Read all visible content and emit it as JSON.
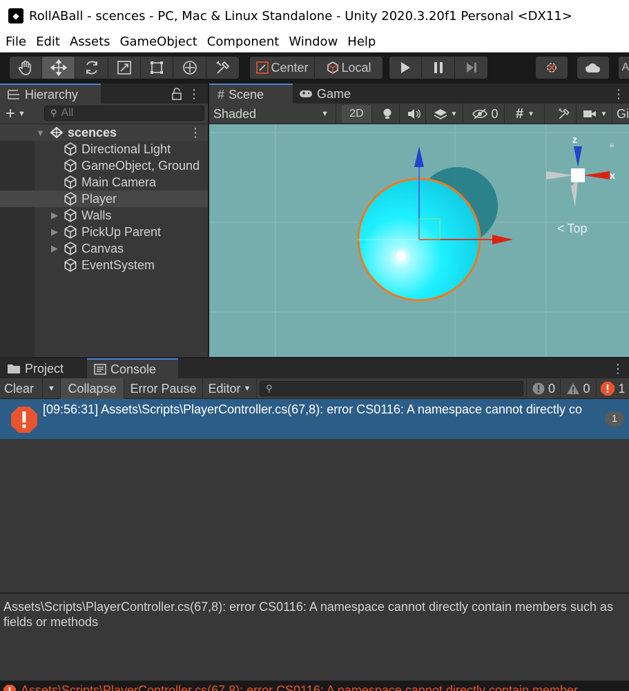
{
  "window": {
    "title": "RollABall - scences - PC, Mac & Linux Standalone - Unity 2020.3.20f1 Personal <DX11>"
  },
  "menu": [
    "File",
    "Edit",
    "Assets",
    "GameObject",
    "Component",
    "Window",
    "Help"
  ],
  "toolbar": {
    "pivot_label": "Center",
    "space_label": "Local"
  },
  "hierarchy": {
    "tab_label": "Hierarchy",
    "search_placeholder": "All",
    "scene_name": "scences",
    "items": [
      {
        "label": "Directional Light"
      },
      {
        "label": "GameObject, Ground"
      },
      {
        "label": "Main Camera"
      },
      {
        "label": "Player"
      },
      {
        "label": "Walls"
      },
      {
        "label": "PickUp Parent"
      },
      {
        "label": "Canvas"
      },
      {
        "label": "EventSystem"
      }
    ],
    "selected_item": "Player"
  },
  "scene": {
    "tabs": [
      {
        "label": "Scene"
      },
      {
        "label": "Game"
      }
    ],
    "shading_mode": "Shaded",
    "mode_2d": "2D",
    "hidden_count": "0",
    "gizmos_label": "Gi",
    "gizmo_axes": {
      "z": "z",
      "x": "x"
    },
    "view_label": "Top"
  },
  "console": {
    "tabs": [
      {
        "label": "Project"
      },
      {
        "label": "Console"
      }
    ],
    "buttons": {
      "clear": "Clear",
      "collapse": "Collapse",
      "error_pause": "Error Pause",
      "editor": "Editor"
    },
    "counts": {
      "log": "0",
      "warning": "0",
      "error": "1"
    },
    "entries": [
      {
        "text": "[09:56:31] Assets\\Scripts\\PlayerController.cs(67,8): error CS0116: A namespace cannot directly co",
        "count": "1"
      }
    ],
    "detail": "Assets\\Scripts\\PlayerController.cs(67,8): error CS0116: A namespace cannot directly contain members such as fields or methods",
    "status_text": "Assets\\Scripts\\PlayerController.cs(67,8): error CS0116: A namespace cannot directly contain member"
  },
  "colors": {
    "accent": "#4a83d6",
    "selection": "#2c5d87",
    "error": "#e8542e",
    "scene_bg": "#76aeae",
    "ball": "#1ef0ff"
  }
}
